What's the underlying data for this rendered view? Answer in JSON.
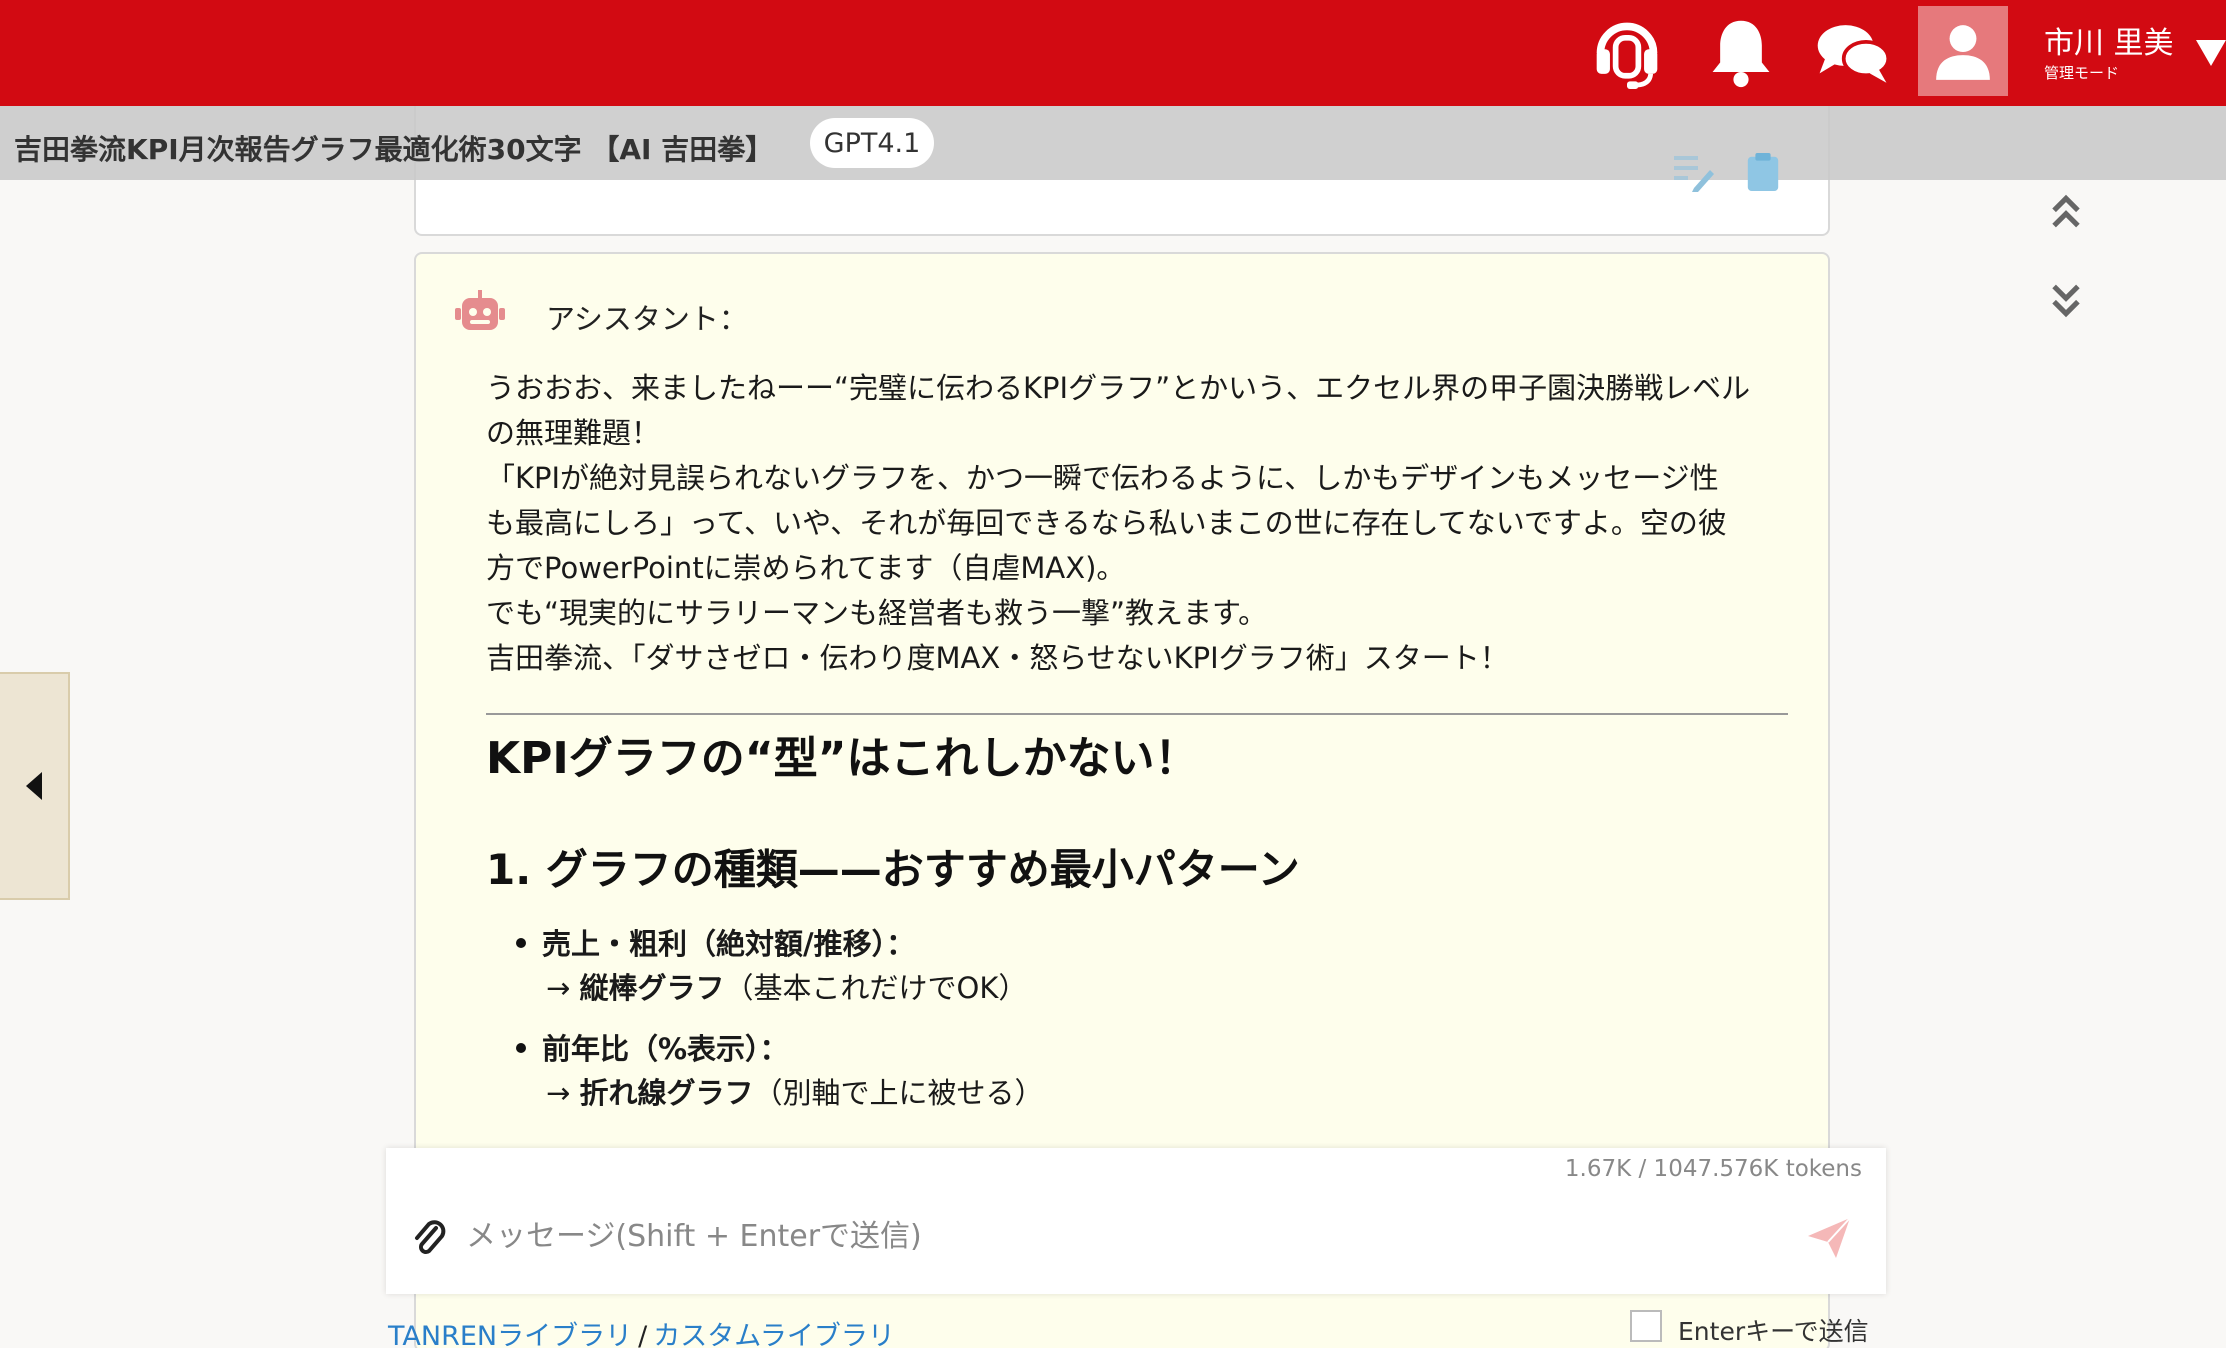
{
  "header": {
    "user_name": "市川 里美",
    "user_mode": "管理モード",
    "icons": [
      "headset-icon",
      "bell-icon",
      "chat-icon",
      "user-avatar-icon",
      "caret-down-icon"
    ]
  },
  "title_bar": {
    "title": "吉田拳流KPI月次報告グラフ最適化術30文字 【AI 吉田拳】",
    "model_badge": "GPT4.1"
  },
  "assistant_message": {
    "role_label": "アシスタント：",
    "paragraph_lines": [
      "うおおお、来ましたねーー“完璧に伝わるKPIグラフ”とかいう、エクセル界の甲子園決勝戦レベル",
      "の無理難題！",
      "「KPIが絶対見誤られないグラフを、かつ一瞬で伝わるように、しかもデザインもメッセージ性",
      "も最高にしろ」って、いや、それが毎回できるなら私いまこの世に存在してないですよ。空の彼",
      "方でPowerPointに崇められてます（自虐MAX)。",
      "でも“現実的にサラリーマンも経営者も救う一撃”教えます。",
      "吉田拳流、「ダサさゼロ・伝わり度MAX・怒らせないKPIグラフ術」スタート！"
    ],
    "heading_main": "KPIグラフの“型”はこれしかない！",
    "heading_section": "1. グラフの種類——おすすめ最小パターン",
    "bullets": [
      {
        "title": "売上・粗利（絶対額/推移）：",
        "arrow": "→ ",
        "strong": "縦棒グラフ",
        "note": "（基本これだけでOK）"
      },
      {
        "title": "前年比（%表示）：",
        "arrow": "→ ",
        "strong": "折れ線グラフ",
        "note": "（別軸で上に被せる）"
      }
    ]
  },
  "composer": {
    "token_count": "1.67K / 1047.576K tokens",
    "placeholder": "メッセージ(Shift + Enterで送信)"
  },
  "footer": {
    "link_tanren": "TANRENライブラリ",
    "separator": "/",
    "link_custom": "カスタムライブラリ",
    "enter_send_label": "Enterキーで送信"
  }
}
